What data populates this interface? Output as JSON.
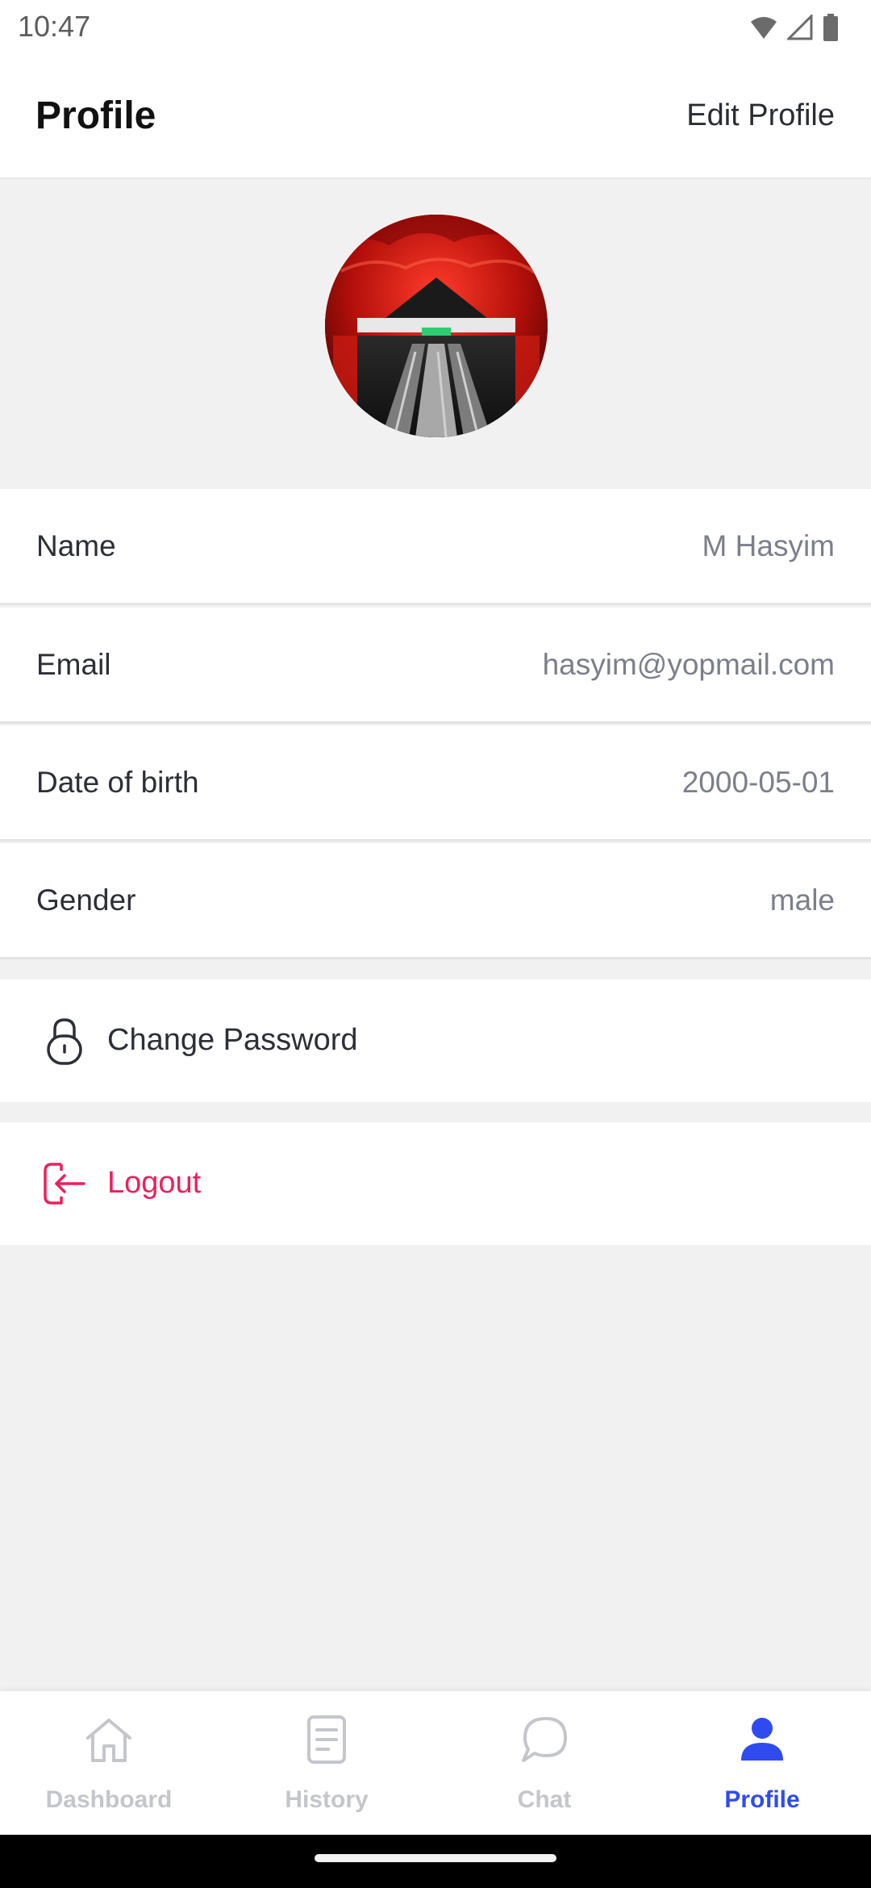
{
  "status_bar": {
    "time": "10:47",
    "icons": [
      "wifi-icon",
      "cell-signal-icon",
      "battery-icon"
    ]
  },
  "header": {
    "title": "Profile",
    "edit_label": "Edit Profile"
  },
  "avatar": {
    "image": "profile-photo"
  },
  "profile_fields": [
    {
      "label": "Name",
      "value": "M Hasyim"
    },
    {
      "label": "Email",
      "value": "hasyim@yopmail.com"
    },
    {
      "label": "Date of birth",
      "value": "2000-05-01"
    },
    {
      "label": "Gender",
      "value": "male"
    }
  ],
  "actions": {
    "change_password": {
      "label": "Change Password",
      "icon": "lock-icon"
    },
    "logout": {
      "label": "Logout",
      "icon": "logout-icon",
      "color": "#ee1f5c"
    }
  },
  "bottom_nav": {
    "items": [
      {
        "label": "Dashboard",
        "icon": "home-icon",
        "active": false
      },
      {
        "label": "History",
        "icon": "document-icon",
        "active": false
      },
      {
        "label": "Chat",
        "icon": "chat-icon",
        "active": false
      },
      {
        "label": "Profile",
        "icon": "person-icon",
        "active": true
      }
    ]
  },
  "colors": {
    "accent": "#2f4bef",
    "inactive": "#c4c6cc",
    "danger": "#ee1f5c",
    "background": "#f1f1f1",
    "value_text": "#7b7f8b"
  }
}
